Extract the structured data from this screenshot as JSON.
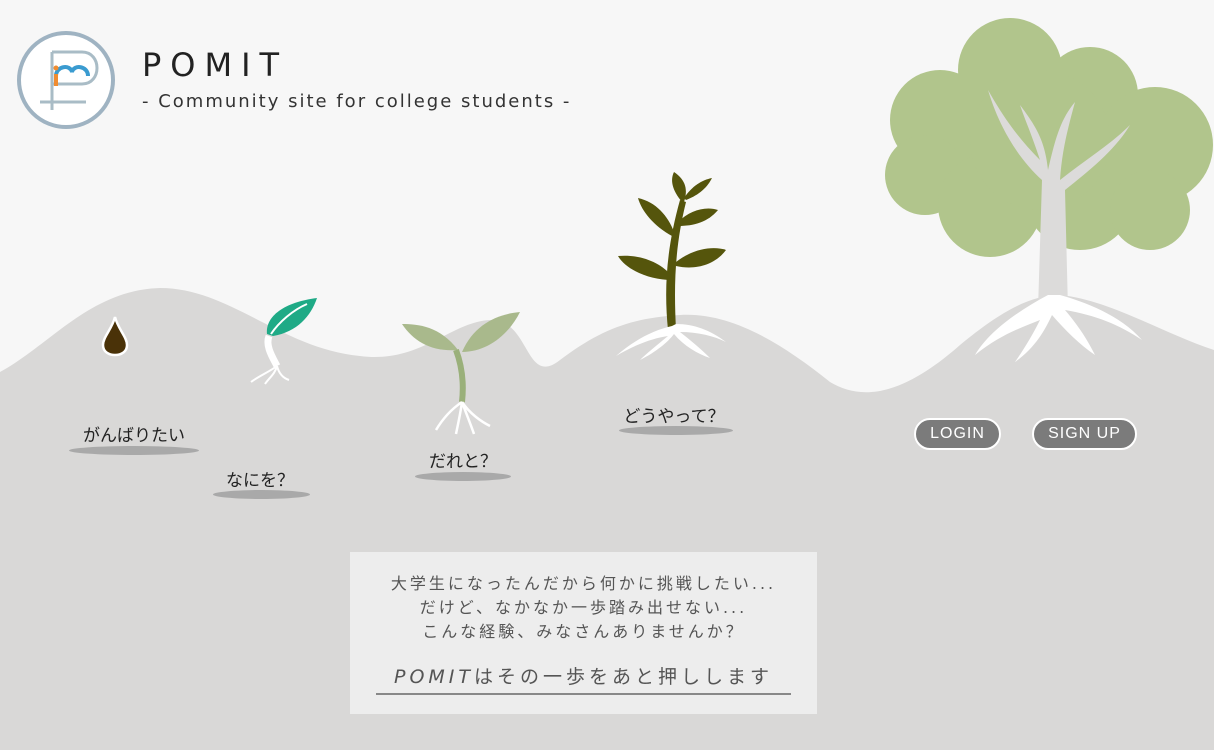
{
  "brand": {
    "title": "POMIT",
    "subtitle": "- Community site for college students -"
  },
  "stages": [
    {
      "label": "がんばりたい",
      "icon": "seed-icon"
    },
    {
      "label": "なにを？",
      "icon": "sprout-icon"
    },
    {
      "label": "だれと？",
      "icon": "seedling-icon"
    },
    {
      "label": "どうやって？",
      "icon": "young-plant-icon"
    }
  ],
  "auth": {
    "login_label": "LOGIN",
    "signup_label": "SIGN UP"
  },
  "message": {
    "lines": [
      "大学生になったんだから何かに挑戦したい...",
      "だけど、なかなか一歩踏み出せない...",
      "こんな経験、みなさんありませんか？"
    ],
    "tagline_brand": "POMIT",
    "tagline_rest": "はその一歩をあと押しします"
  },
  "colors": {
    "hill": "#d9d8d7",
    "tree_canopy": "#b1c58c",
    "sprout_teal": "#1faa86",
    "seedling_green": "#a9b98c",
    "plant_olive": "#55550c",
    "seed_brown": "#4a3208",
    "button": "#7b7b7b"
  }
}
